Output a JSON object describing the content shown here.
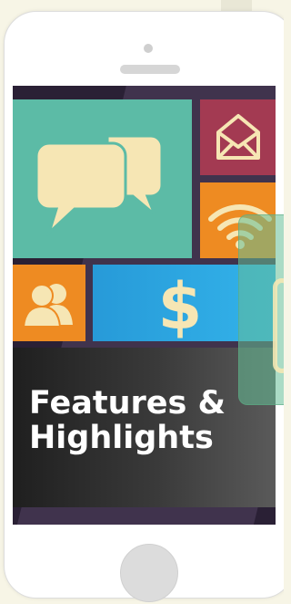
{
  "screen": {
    "banner": {
      "title_line1": "Features &",
      "title_line2": "Highlights"
    },
    "tiles": [
      {
        "icon": "chat-bubbles-icon",
        "color": "#5cbba6"
      },
      {
        "icon": "envelope-icon",
        "color": "#a33a52"
      },
      {
        "icon": "wifi-icon",
        "color": "#ee8b22"
      },
      {
        "icon": "people-icon",
        "color": "#ee8b22"
      },
      {
        "icon": "dollar-icon",
        "color": "#279ad8"
      }
    ],
    "icon_color": "#f6e6b4"
  }
}
